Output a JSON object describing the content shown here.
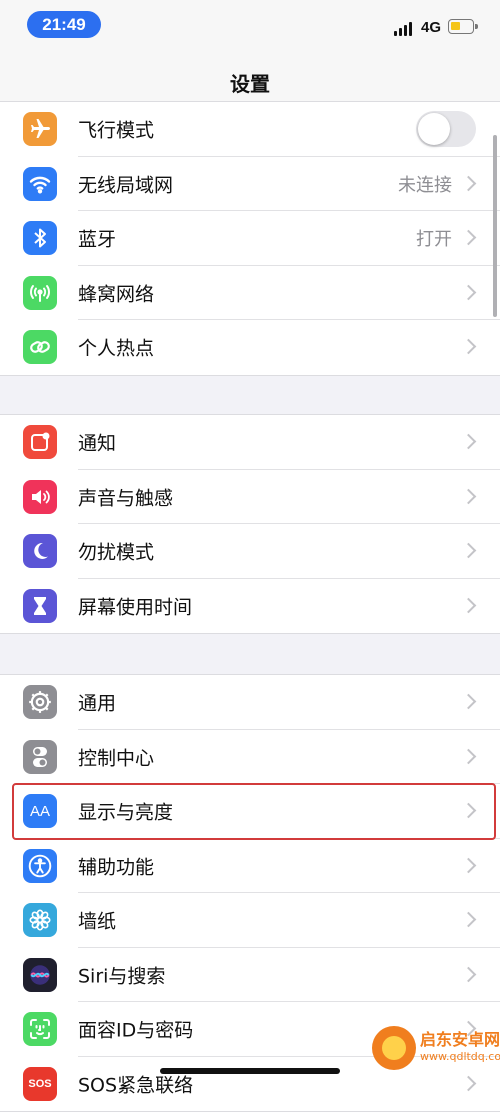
{
  "status_bar": {
    "time": "21:49",
    "network": "4G",
    "battery_level": 0.45,
    "battery_color": "#f5c518",
    "time_pill_color": "#2c6ff0"
  },
  "title": "设置",
  "groups": [
    {
      "items": [
        {
          "label": "飞行模式",
          "icon": "airplane-icon",
          "icon_color": "#f19a38",
          "control": "toggle",
          "toggle_on": false
        },
        {
          "label": "无线局域网",
          "icon": "wifi-icon",
          "icon_color": "#2e7cf6",
          "value": "未连接"
        },
        {
          "label": "蓝牙",
          "icon": "bluetooth-icon",
          "icon_color": "#2e7cf6",
          "value": "打开"
        },
        {
          "label": "蜂窝网络",
          "icon": "cellular-antenna-icon",
          "icon_color": "#4cd964"
        },
        {
          "label": "个人热点",
          "icon": "hotspot-link-icon",
          "icon_color": "#4cd964"
        }
      ]
    },
    {
      "items": [
        {
          "label": "通知",
          "icon": "notification-icon",
          "icon_color": "#f04a3c"
        },
        {
          "label": "声音与触感",
          "icon": "speaker-icon",
          "icon_color": "#f0335a"
        },
        {
          "label": "勿扰模式",
          "icon": "moon-icon",
          "icon_color": "#5b55d6"
        },
        {
          "label": "屏幕使用时间",
          "icon": "hourglass-icon",
          "icon_color": "#5b55d6"
        }
      ]
    },
    {
      "items": [
        {
          "label": "通用",
          "icon": "gear-icon",
          "icon_color": "#8e8e93"
        },
        {
          "label": "控制中心",
          "icon": "toggles-icon",
          "icon_color": "#8e8e93"
        },
        {
          "label": "显示与亮度",
          "icon": "display-aa-icon",
          "icon_color": "#2e7cf6",
          "highlighted": true
        },
        {
          "label": "辅助功能",
          "icon": "accessibility-icon",
          "icon_color": "#2e7cf6"
        },
        {
          "label": "墙纸",
          "icon": "flower-icon",
          "icon_color": "#35a8dc"
        },
        {
          "label": "Siri与搜索",
          "icon": "siri-icon",
          "icon_color": "#1f1f2e"
        },
        {
          "label": "面容ID与密码",
          "icon": "face-id-icon",
          "icon_color": "#4cd964"
        },
        {
          "label": "SOS紧急联络",
          "icon": "sos-icon",
          "icon_color": "#e8382c"
        }
      ]
    }
  ],
  "highlight_color": "#d23b3b",
  "watermark": {
    "name": "启东安卓网",
    "url": "www.qdltdq.com"
  }
}
